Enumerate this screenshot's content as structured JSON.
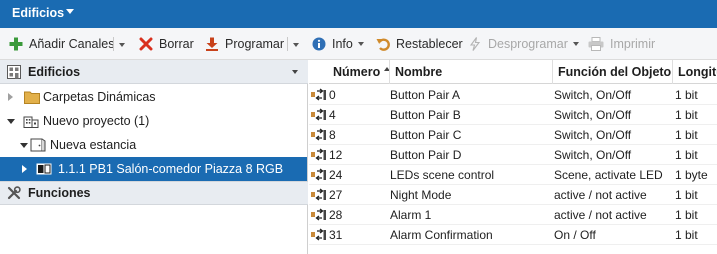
{
  "app": {
    "title": "Edificios"
  },
  "toolbar": {
    "add_channels": "Añadir Canales",
    "delete": "Borrar",
    "program": "Programar",
    "info": "Info",
    "restore": "Restablecer",
    "unprogram": "Desprogramar",
    "print": "Imprimir"
  },
  "tree": {
    "header": "Edificios",
    "items": [
      {
        "label": "Carpetas Dinámicas"
      },
      {
        "label": "Nuevo proyecto (1)"
      },
      {
        "label": "Nueva estancia"
      },
      {
        "label": "1.1.1 PB1 Salón-comedor Piazza 8 RGB"
      }
    ],
    "functions_header": "Funciones"
  },
  "table": {
    "columns": [
      "Número",
      "Nombre",
      "Función del Objeto",
      "Longitu"
    ],
    "sort_column": "Número",
    "rows": [
      {
        "number": "0",
        "name": "Button Pair A",
        "function": "Switch, On/Off",
        "length": "1 bit"
      },
      {
        "number": "4",
        "name": "Button Pair B",
        "function": "Switch, On/Off",
        "length": "1 bit"
      },
      {
        "number": "8",
        "name": "Button Pair C",
        "function": "Switch, On/Off",
        "length": "1 bit"
      },
      {
        "number": "12",
        "name": "Button Pair D",
        "function": "Switch, On/Off",
        "length": "1 bit"
      },
      {
        "number": "24",
        "name": "LEDs scene control",
        "function": "Scene, activate LED",
        "length": "1 byte"
      },
      {
        "number": "27",
        "name": "Night Mode",
        "function": "active / not active",
        "length": "1 bit"
      },
      {
        "number": "28",
        "name": "Alarm 1",
        "function": "active / not active",
        "length": "1 bit"
      },
      {
        "number": "31",
        "name": "Alarm Confirmation",
        "function": "On / Off",
        "length": "1 bit"
      }
    ]
  },
  "colors": {
    "accent": "#1a6bb2",
    "add": "#3a9a3a",
    "delete": "#d9301e",
    "program": "#c8421b",
    "info": "#2f6fb5",
    "restore": "#d08a2b"
  },
  "icons": {
    "add": "plus-icon",
    "delete": "x-icon",
    "program": "download-arrow-icon",
    "info": "info-circle-icon",
    "restore": "undo-icon",
    "unprogram": "lightning-icon",
    "print": "printer-icon",
    "tree_header": "building-icon",
    "functions": "tools-icon",
    "object": "group-object-icon"
  }
}
